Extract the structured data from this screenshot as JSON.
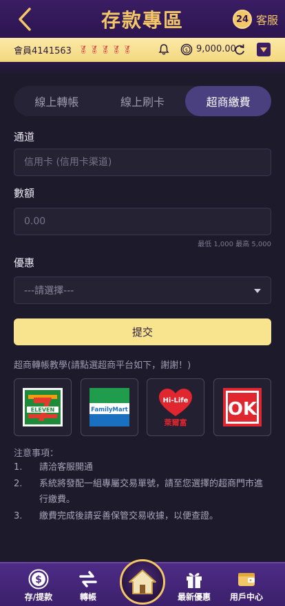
{
  "header": {
    "title": "存款專區",
    "service_badge": "24",
    "service_label": "客服"
  },
  "member": {
    "id": "會員4141563",
    "balance": "9,000.00",
    "medal_count": 5
  },
  "tabs": [
    {
      "label": "線上轉帳",
      "active": false
    },
    {
      "label": "線上刷卡",
      "active": false
    },
    {
      "label": "超商繳費",
      "active": true
    }
  ],
  "form": {
    "channel_label": "通道",
    "channel_placeholder": "信用卡 (信用卡渠道)",
    "amount_label": "數額",
    "amount_placeholder": "0.00",
    "amount_hint": "最低 1,000 最高 5,000",
    "promo_label": "優惠",
    "promo_selected": "---請選擇---",
    "submit_label": "提交"
  },
  "tutorial_text": "超商轉帳教學(請點選超商平台如下，謝謝！)",
  "stores": [
    {
      "name": "7-ELEVEN",
      "text": "ELEVEN"
    },
    {
      "name": "FamilyMart",
      "text": "FamilyMart"
    },
    {
      "name": "Hi-Life",
      "text": "萊爾富"
    },
    {
      "name": "OK",
      "text": "OK"
    }
  ],
  "notes": {
    "title": "注意事項：",
    "items": [
      {
        "num": "1.",
        "text": "請洽客服開通"
      },
      {
        "num": "2.",
        "text": "系統將發配一組專屬交易單號，請至您選擇的超商門市進行繳費。"
      },
      {
        "num": "3.",
        "text": "繳費完成後請妥善保管交易收據，以便查證。"
      }
    ]
  },
  "bottom_nav": [
    {
      "label": "存/提款",
      "icon": "dollar-coin-icon"
    },
    {
      "label": "轉帳",
      "icon": "transfer-arrows-icon"
    },
    {
      "label": "首頁",
      "icon": "home-icon"
    },
    {
      "label": "最新優惠",
      "icon": "gift-icon"
    },
    {
      "label": "用戶中心",
      "icon": "wallet-icon"
    }
  ],
  "colors": {
    "gold": "#f3c768",
    "accent_purple": "#4a4080",
    "submit_bg": "#f8e48e"
  }
}
